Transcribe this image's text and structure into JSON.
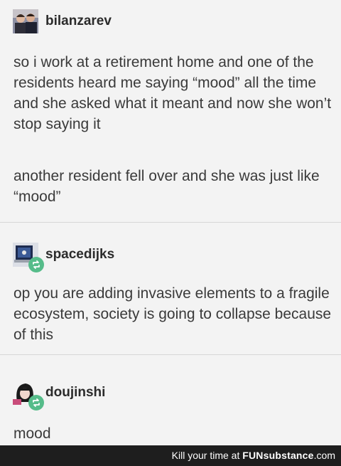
{
  "posts": [
    {
      "username": "bilanzarev",
      "paragraphs": [
        "so i work at a retirement home and one of the residents heard me saying “mood” all the time and she asked what it meant and now she won’t stop saying it",
        "another resident fell over and she was just like “mood”"
      ],
      "avatar_icon": "photo-avatar-icon"
    },
    {
      "username": "spacedijks",
      "paragraphs": [
        "op you are adding invasive elements to a fragile ecosystem, society is going to collapse because of this"
      ],
      "avatar_icon": "laptop-avatar-icon",
      "reblog_icon": "reblog-icon"
    },
    {
      "username": "doujinshi",
      "paragraphs": [
        "mood"
      ],
      "avatar_icon": "anime-avatar-icon",
      "reblog_icon": "reblog-icon"
    }
  ],
  "footer": {
    "text_before": "Kill your time at ",
    "brand": "FUNsubstance",
    "domain": ".com"
  },
  "colors": {
    "background": "#f3f3f3",
    "text": "#3a3a3a",
    "reblog_badge": "#56bc8a",
    "footer_bg": "#1e1e1e"
  }
}
